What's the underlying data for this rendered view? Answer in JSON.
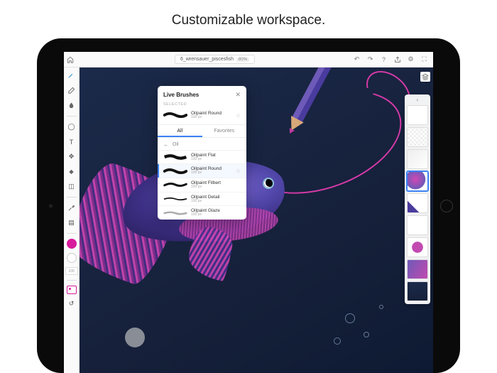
{
  "caption": "Customizable workspace.",
  "topbar": {
    "document_title": "6_wrensauer_piscesfish",
    "zoom": "80%"
  },
  "left_tool": {
    "opacity_label": "100"
  },
  "brushes": {
    "title": "Live Brushes",
    "selected_section": "SELECTED",
    "selected_brush": {
      "name": "Oilpaint Round",
      "size": "100 px"
    },
    "tabs": {
      "all": "All",
      "favorites": "Favorites"
    },
    "category": "Oil",
    "list": [
      {
        "name": "Oilpaint Flat",
        "size": "100 px"
      },
      {
        "name": "Oilpaint Round",
        "size": "100 px"
      },
      {
        "name": "Oilpaint Filbert",
        "size": "100 px"
      },
      {
        "name": "Oilpaint Detail",
        "size": "100 px"
      },
      {
        "name": "Oilpaint Glaze",
        "size": "100 px"
      }
    ]
  },
  "colors": {
    "active": "#d81b9c",
    "secondary": "#ffffff"
  }
}
